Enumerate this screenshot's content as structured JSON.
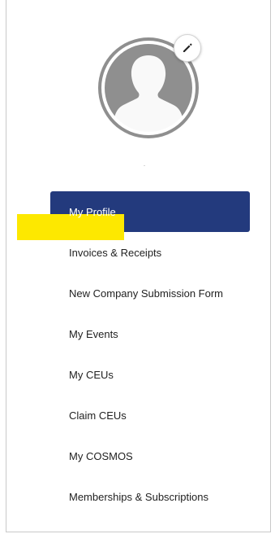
{
  "profile": {
    "avatar_icon": "user-silhouette-icon",
    "edit_icon": "pencil-icon"
  },
  "nav": {
    "items": [
      {
        "label": "My Profile",
        "active": true
      },
      {
        "label": "Invoices & Receipts"
      },
      {
        "label": "New Company Submission Form"
      },
      {
        "label": "My Events"
      },
      {
        "label": "My CEUs"
      },
      {
        "label": "Claim CEUs",
        "highlighted": true
      },
      {
        "label": "My COSMOS"
      },
      {
        "label": "Memberships & Subscriptions"
      }
    ]
  },
  "colors": {
    "active_bg": "#233a7d",
    "highlight": "#fde800",
    "avatar": "#8f8f8f"
  }
}
